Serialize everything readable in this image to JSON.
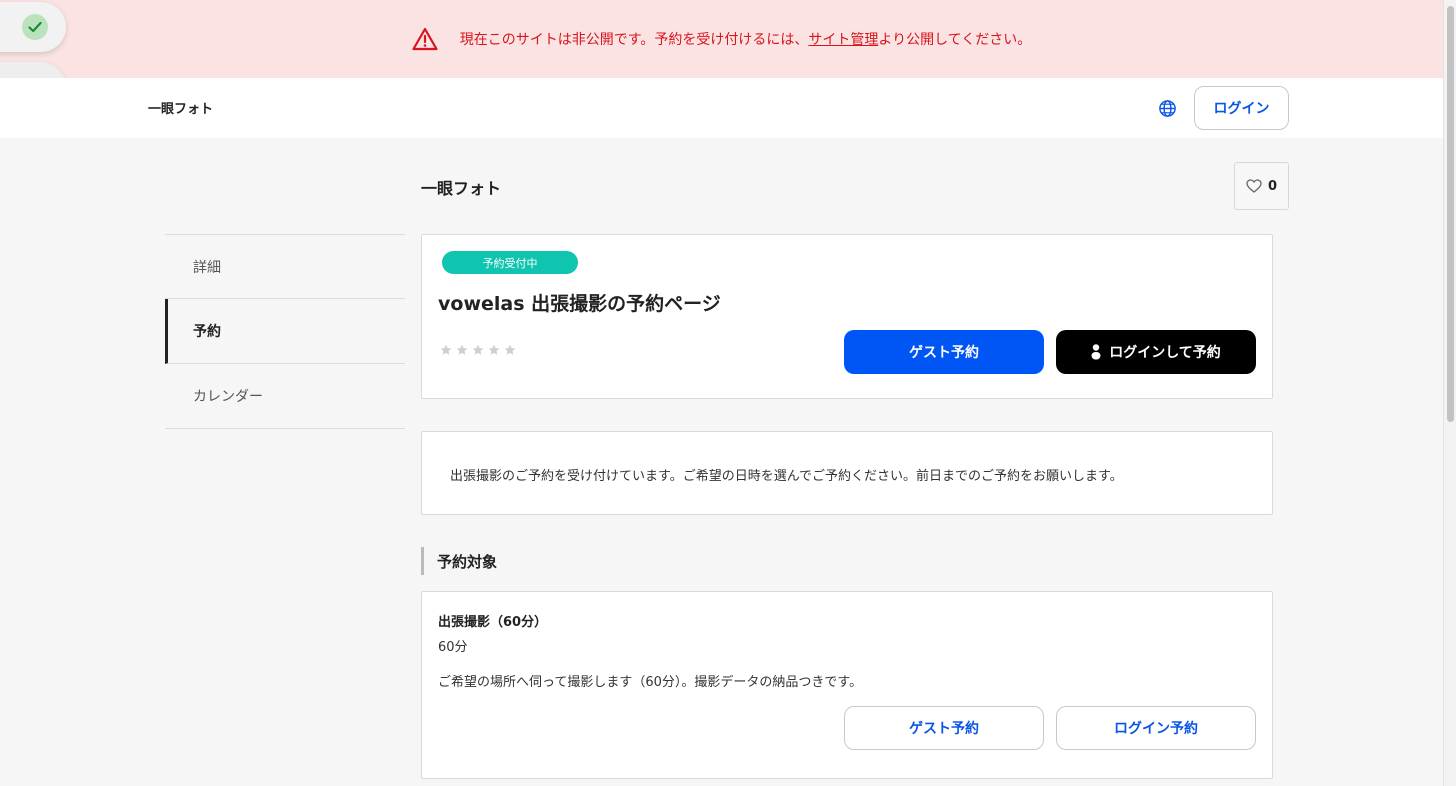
{
  "alert": {
    "text_before": "現在このサイトは非公開です。予約を受け付けるには、",
    "link": "サイト管理",
    "text_after": "より公開してください。",
    "color": "#d8141d",
    "background": "#fbe3e3"
  },
  "header": {
    "site_name": "一眼フォト",
    "login_label": "ログイン"
  },
  "page": {
    "title": "一眼フォト",
    "favorite_count": "0"
  },
  "sidebar": {
    "items": [
      {
        "label": "詳細",
        "active": false
      },
      {
        "label": "予約",
        "active": true
      },
      {
        "label": "カレンダー",
        "active": false
      }
    ]
  },
  "booking": {
    "status_badge": "予約受付中",
    "title": "vowelas 出張撮影の予約ページ",
    "rating": 0,
    "rating_max": 5,
    "guest_button": "ゲスト予約",
    "login_button": "ログインして予約",
    "description": "出張撮影のご予約を受け付けています。ご希望の日時を選んでご予約ください。前日までのご予約をお願いします。"
  },
  "section": {
    "heading": "予約対象"
  },
  "item": {
    "name": "出張撮影（60分）",
    "duration": "60分",
    "description": "ご希望の場所へ伺って撮影します（60分）。撮影データの納品つきです。",
    "guest_button": "ゲスト予約",
    "login_button": "ログイン予約"
  },
  "colors": {
    "primary": "#0055f5",
    "badge": "#0fc5b0",
    "link_text": "#0a55e6"
  },
  "icons": {
    "alert": "warning-triangle-icon",
    "toast": "check-icon",
    "language": "globe-icon",
    "favorite": "heart-icon",
    "user": "user-icon",
    "rating": "star-icon"
  }
}
